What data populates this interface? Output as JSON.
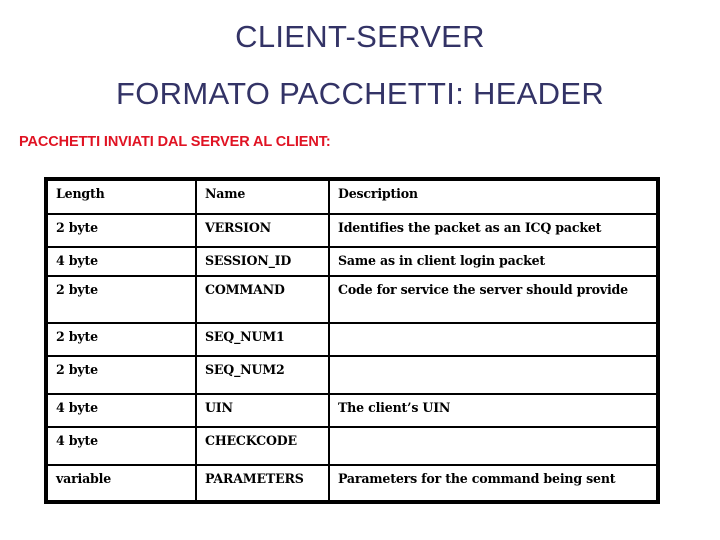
{
  "slide": {
    "title_line1": "CLIENT-SERVER",
    "title_line2": "FORMATO PACCHETTI: HEADER",
    "subtitle": "PACCHETTI INVIATI DAL SERVER AL CLIENT:",
    "colors": {
      "title": "#333366",
      "subtitle": "#e01323",
      "name_column": "#333366",
      "body_text": "#000000",
      "background": "#ffffff",
      "border": "#000000"
    }
  },
  "table": {
    "headers": {
      "length": "Length",
      "name": "Name",
      "description": "Description"
    },
    "rows": [
      {
        "length": "2 byte",
        "name": "VERSION",
        "description": "Identifies the packet as an ICQ packet"
      },
      {
        "length": "4 byte",
        "name": "SESSION_ID",
        "description": "Same as in client login packet"
      },
      {
        "length": "2 byte",
        "name": "COMMAND",
        "description": "Code for service the server should provide"
      },
      {
        "length": "2 byte",
        "name": "SEQ_NUM1",
        "description": ""
      },
      {
        "length": "2 byte",
        "name": "SEQ_NUM2",
        "description": ""
      },
      {
        "length": "4 byte",
        "name": "UIN",
        "description": "The client’s UIN"
      },
      {
        "length": "4 byte",
        "name": "CHECKCODE",
        "description": ""
      },
      {
        "length": "variable",
        "name": "PARAMETERS",
        "description": "Parameters for the command being sent"
      }
    ]
  }
}
